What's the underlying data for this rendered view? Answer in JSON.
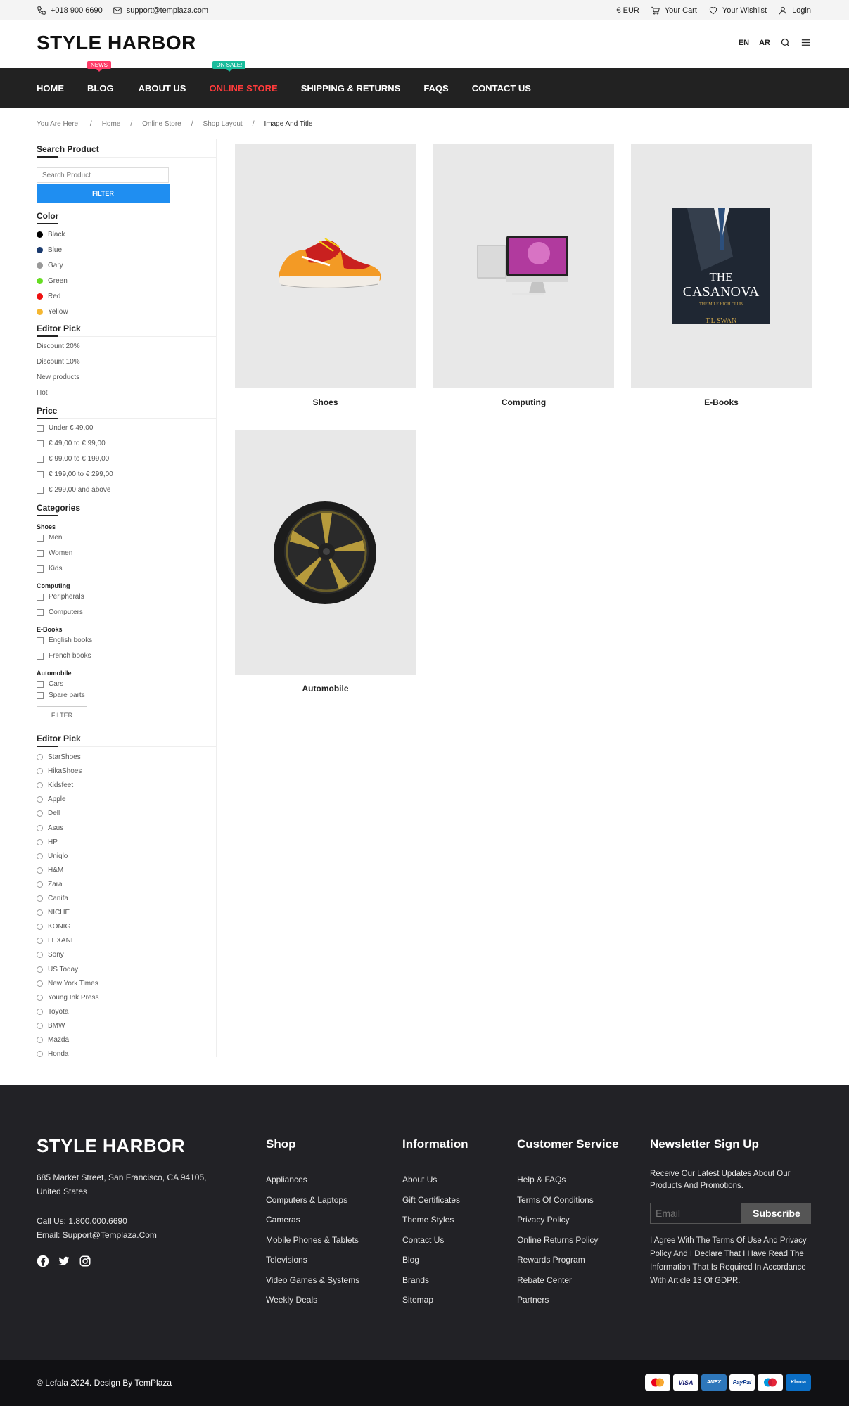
{
  "topbar": {
    "phone": "+018 900 6690",
    "email": "support@templaza.com",
    "currency": "€ EUR",
    "cart": "Your Cart",
    "wishlist": "Your Wishlist",
    "login": "Login"
  },
  "header": {
    "logo": "STYLE HARBOR",
    "lang_en": "EN",
    "lang_ar": "AR"
  },
  "nav": {
    "items": [
      {
        "label": "HOME"
      },
      {
        "label": "BLOG",
        "badge": "NEWS"
      },
      {
        "label": "ABOUT US"
      },
      {
        "label": "ONLINE STORE",
        "badge": "ON SALE!"
      },
      {
        "label": "SHIPPING & RETURNS"
      },
      {
        "label": "FAQS"
      },
      {
        "label": "CONTACT US"
      }
    ]
  },
  "breadcrumb": {
    "prefix": "You Are Here:",
    "items": [
      "Home",
      "Online Store",
      "Shop Layout",
      "Image And Title"
    ],
    "separator": "/"
  },
  "sidebar": {
    "search_title": "Search Product",
    "search_placeholder": "Search Product",
    "filter_label": "FILTER",
    "color_title": "Color",
    "colors": [
      {
        "label": "Black",
        "hex": "#000000"
      },
      {
        "label": "Blue",
        "hex": "#1a3a6e"
      },
      {
        "label": "Gary",
        "hex": "#999999"
      },
      {
        "label": "Green",
        "hex": "#66dd22"
      },
      {
        "label": "Red",
        "hex": "#ee1111"
      },
      {
        "label": "Yellow",
        "hex": "#f5b731"
      }
    ],
    "editor_pick_title": "Editor Pick",
    "editor_picks": [
      "Discount 20%",
      "Discount 10%",
      "New products",
      "Hot"
    ],
    "price_title": "Price",
    "prices": [
      "Under € 49,00",
      "€ 49,00 to € 99,00",
      "€ 99,00 to € 199,00",
      "€ 199,00 to € 299,00",
      "€ 299,00 and above"
    ],
    "categories_title": "Categories",
    "categories": {
      "shoes": {
        "title": "Shoes",
        "items": [
          "Men",
          "Women",
          "Kids"
        ]
      },
      "computing": {
        "title": "Computing",
        "items": [
          "Peripherals",
          "Computers"
        ]
      },
      "ebooks": {
        "title": "E-Books",
        "items": [
          "English books",
          "French books"
        ]
      },
      "automobile": {
        "title": "Automobile",
        "items": [
          "Cars",
          "Spare parts"
        ]
      }
    },
    "filter_label_2": "FILTER",
    "brands_title": "Editor Pick",
    "brands": [
      "StarShoes",
      "HikaShoes",
      "Kidsfeet",
      "Apple",
      "Dell",
      "Asus",
      "HP",
      "Uniqlo",
      "H&M",
      "Zara",
      "Canifa",
      "NICHE",
      "KONIG",
      "LEXANI",
      "Sony",
      "US Today",
      "New York Times",
      "Young Ink Press",
      "Toyota",
      "BMW",
      "Mazda",
      "Honda"
    ]
  },
  "products": [
    {
      "title": "Shoes",
      "icon": "sneaker-image"
    },
    {
      "title": "Computing",
      "icon": "computer-image"
    },
    {
      "title": "E-Books",
      "icon": "book-cover-image",
      "book_title_1": "THE",
      "book_title_2": "CASANOVA",
      "book_subtitle": "THE MILE HIGH CLUB",
      "book_author": "T.L SWAN"
    },
    {
      "title": "Automobile",
      "icon": "wheel-image"
    }
  ],
  "footer": {
    "logo": "STYLE HARBOR",
    "address": "685 Market Street, San Francisco, CA 94105, United States",
    "call": "Call Us: 1.800.000.6690",
    "email": "Email: Support@Templaza.Com",
    "shop_title": "Shop",
    "shop_links": [
      "Appliances",
      "Computers & Laptops",
      "Cameras",
      "Mobile Phones & Tablets",
      "Televisions",
      "Video Games & Systems",
      "Weekly Deals"
    ],
    "info_title": "Information",
    "info_links": [
      "About Us",
      "Gift Certificates",
      "Theme Styles",
      "Contact Us",
      "Blog",
      "Brands",
      "Sitemap"
    ],
    "service_title": "Customer Service",
    "service_links": [
      "Help & FAQs",
      "Terms Of Conditions",
      "Privacy Policy",
      "Online Returns Policy",
      "Rewards Program",
      "Rebate Center",
      "Partners"
    ],
    "newsletter_title": "Newsletter Sign Up",
    "newsletter_text": "Receive Our Latest Updates About Our Products And Promotions.",
    "newsletter_placeholder": "Email",
    "subscribe_label": "Subscribe",
    "gdpr_text": "I Agree With The Terms Of Use And Privacy Policy And I Declare That I Have Read The Information That Is Required In Accordance With Article 13 Of GDPR.",
    "copyright": "© Lefala 2024. Design By TemPlaza",
    "payments": [
      {
        "label": "",
        "icon": "mastercard-icon"
      },
      {
        "label": "VISA",
        "icon": "visa-icon"
      },
      {
        "label": "AMEX",
        "icon": "amex-icon"
      },
      {
        "label": "PayPal",
        "icon": "paypal-icon"
      },
      {
        "label": "",
        "icon": "maestro-icon"
      },
      {
        "label": "Klarna",
        "icon": "klarna-icon"
      }
    ]
  },
  "colors": {
    "nav_bg": "#222222",
    "accent_red": "#ff3b3b",
    "filter_blue": "#1f8ef1",
    "footer_bg": "#222226"
  }
}
